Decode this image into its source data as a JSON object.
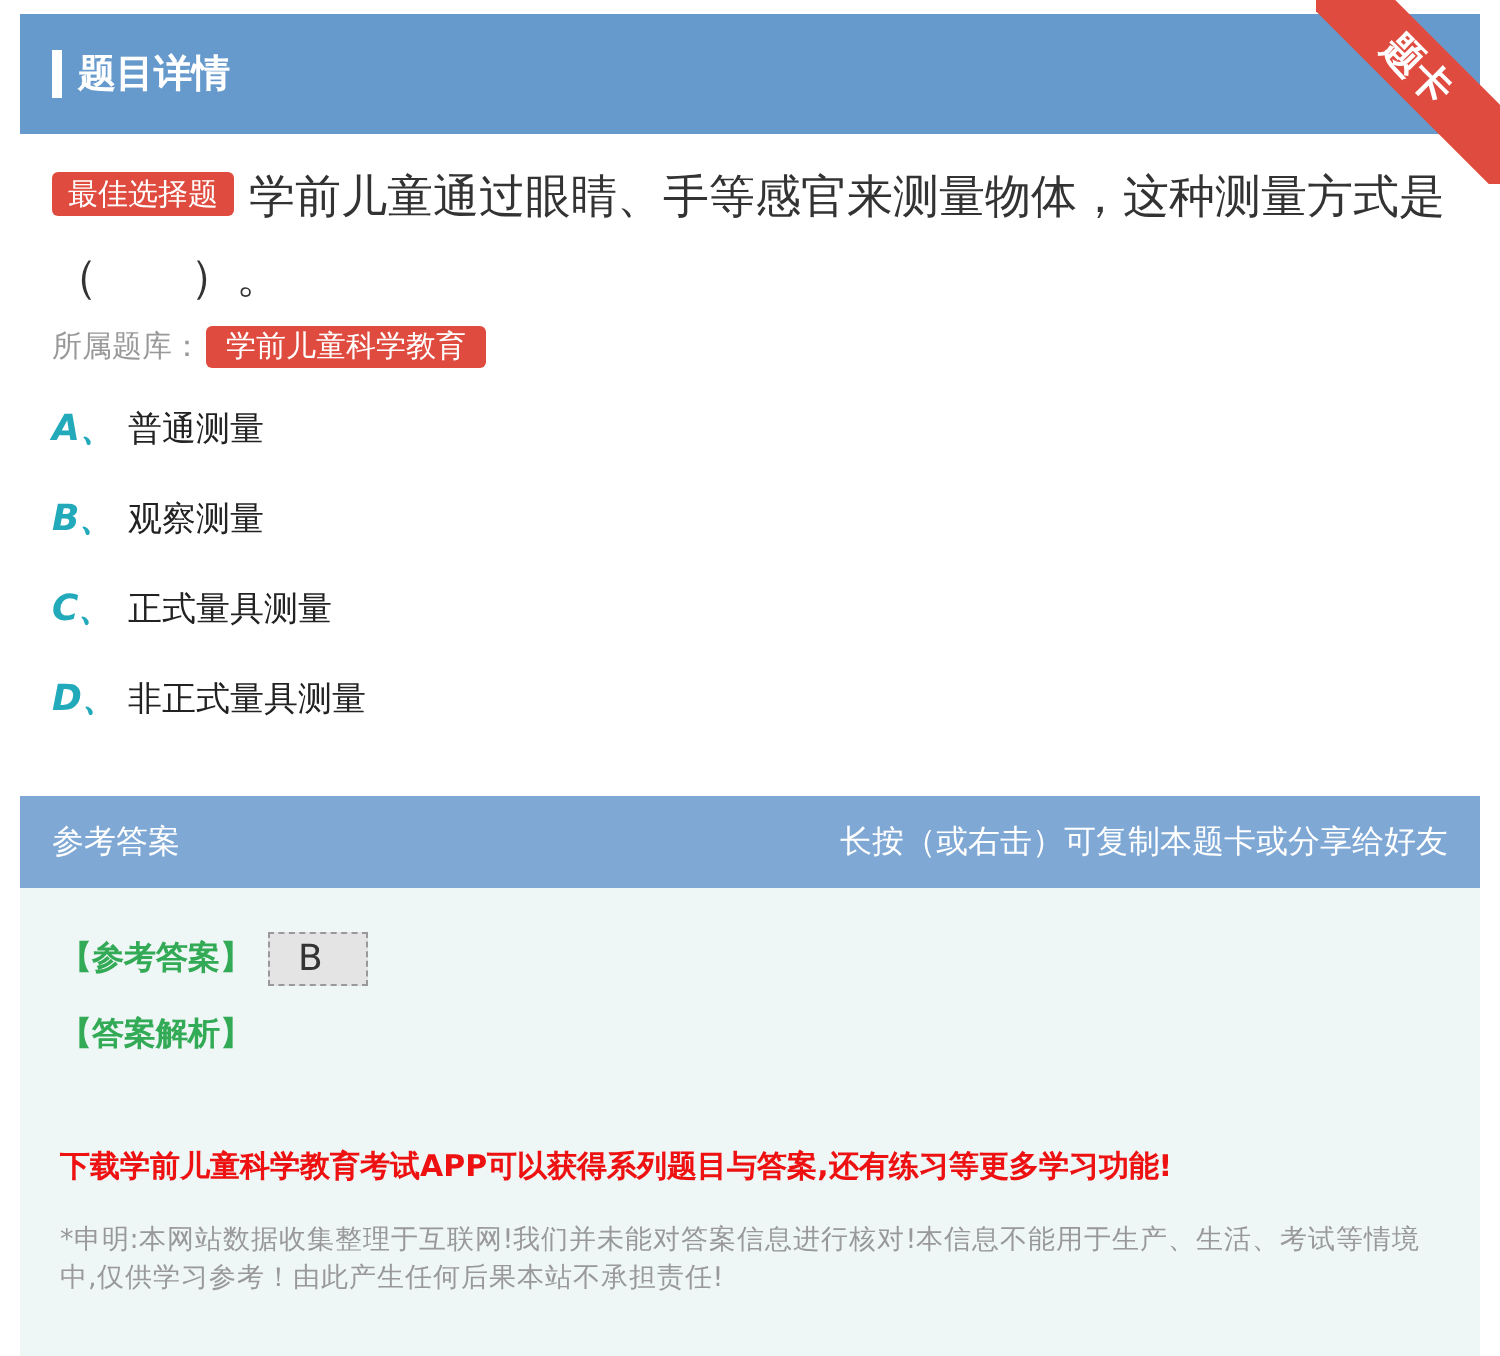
{
  "header": {
    "title": "题目详情",
    "ribbon": "题卡"
  },
  "question": {
    "type_badge": "最佳选择题",
    "text": "学前儿童通过眼睛、手等感官来测量物体，这种测量方式是（　　）。",
    "bank_label": "所属题库：",
    "bank": "学前儿童科学教育"
  },
  "options": [
    {
      "letter": "A、",
      "text": "普通测量"
    },
    {
      "letter": "B、",
      "text": "观察测量"
    },
    {
      "letter": "C、",
      "text": "正式量具测量"
    },
    {
      "letter": "D、",
      "text": "非正式量具测量"
    }
  ],
  "answer_bar": {
    "title": "参考答案",
    "hint": "长按（或右击）可复制本题卡或分享给好友"
  },
  "answer": {
    "label": "【参考答案】",
    "value": "B",
    "analysis_label": "【答案解析】"
  },
  "promo": "下载学前儿童科学教育考试APP可以获得系列题目与答案,还有练习等更多学习功能!",
  "disclaimer": "*申明:本网站数据收集整理于互联网!我们并未能对答案信息进行核对!本信息不能用于生产、生活、考试等情境中,仅供学习参考！由此产生任何后果本站不承担责任!"
}
